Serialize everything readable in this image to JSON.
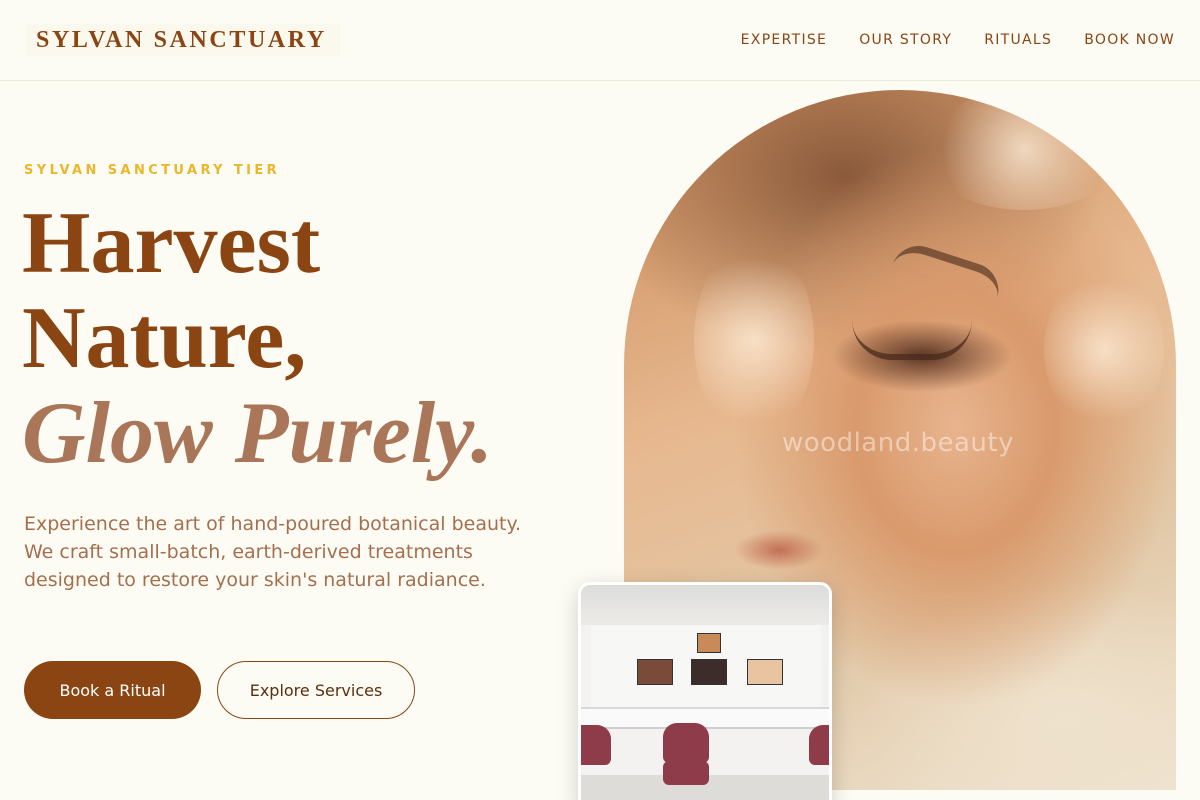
{
  "header": {
    "logo": "SYLVAN SANCTUARY",
    "nav": [
      "EXPERTISE",
      "OUR STORY",
      "RITUALS",
      "BOOK NOW"
    ]
  },
  "hero": {
    "eyebrow": "SYLVAN SANCTUARY TIER",
    "headline_line1": "Harvest",
    "headline_line2": "Nature,",
    "headline_line3": "Glow Purely.",
    "description": "Experience the art of hand-poured botanical beauty. We craft small-batch, earth-derived treatments designed to restore your skin's natural radiance.",
    "primary_cta": "Book a Ritual",
    "secondary_cta": "Explore Services"
  },
  "images": {
    "arch_watermark": "woodland.beauty"
  },
  "colors": {
    "brand": "#8a4513",
    "accent": "#e9b729",
    "background": "#fdfcf4",
    "italic": "#a9765a"
  }
}
